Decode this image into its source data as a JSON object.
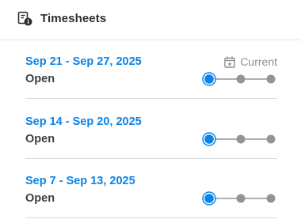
{
  "header": {
    "title": "Timesheets",
    "icon": "timesheet-clock-icon"
  },
  "timesheets": [
    {
      "range": "Sep 21 - Sep 27, 2025",
      "status": "Open",
      "current_label": "Current",
      "current_icon": "calendar-star-icon",
      "steps_completed": 1,
      "steps_total": 3
    },
    {
      "range": "Sep 14 - Sep 20, 2025",
      "status": "Open",
      "steps_completed": 1,
      "steps_total": 3
    },
    {
      "range": "Sep 7 - Sep 13, 2025",
      "status": "Open",
      "steps_completed": 1,
      "steps_total": 3
    }
  ],
  "colors": {
    "accent": "#0a84e8",
    "step_inactive": "#8f959b",
    "divider": "#d8dbdf",
    "text": "#2b2f33"
  }
}
